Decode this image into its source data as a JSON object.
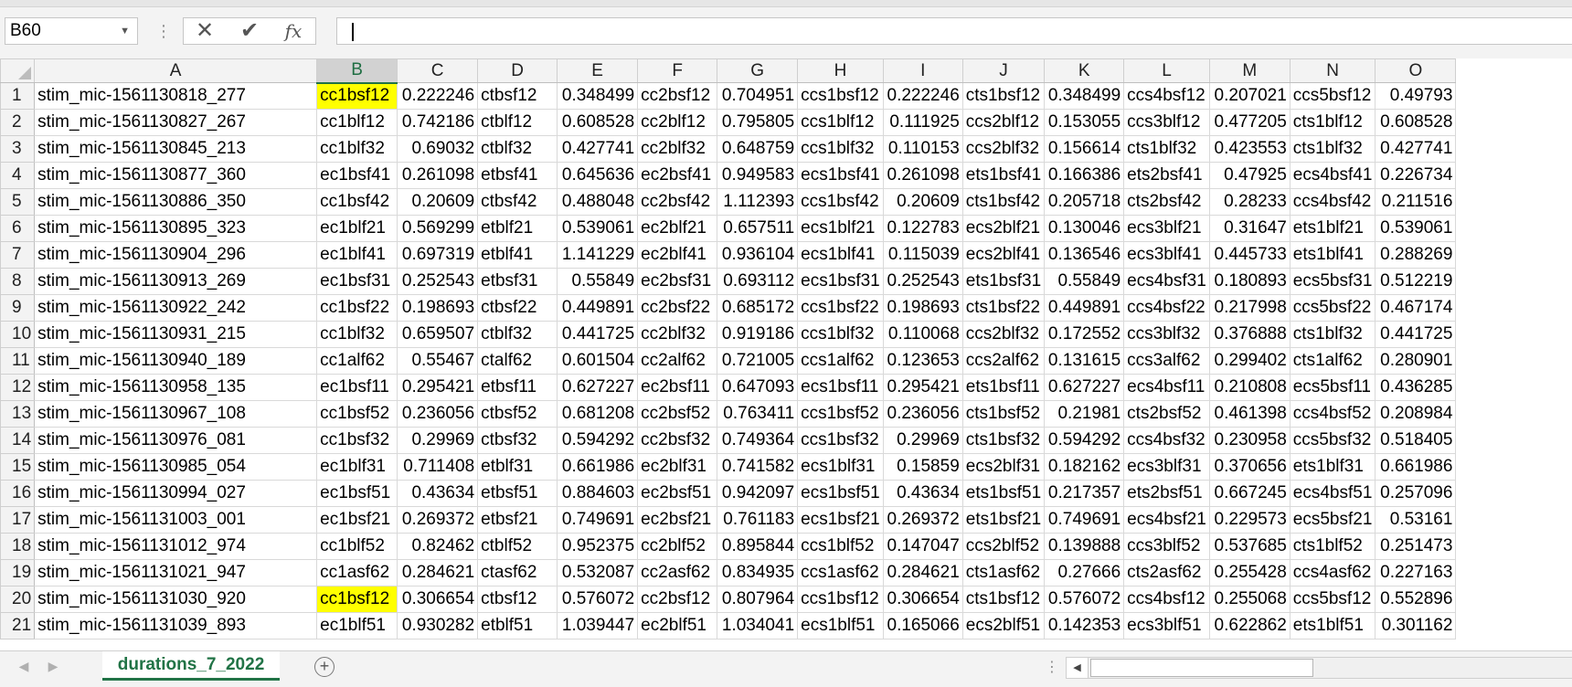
{
  "name_box": {
    "value": "B60"
  },
  "formula_bar": {
    "cancel_icon": "x-icon",
    "enter_icon": "check-icon",
    "function_label": "fx",
    "value": ""
  },
  "columns": [
    "A",
    "B",
    "C",
    "D",
    "E",
    "F",
    "G",
    "H",
    "I",
    "J",
    "K",
    "L",
    "M",
    "N",
    "O"
  ],
  "selected_column": "B",
  "rows": [
    {
      "n": "1",
      "cells": [
        "stim_mic-1561130818_277",
        "cc1bsf12",
        "0.222246",
        "ctbsf12",
        "0.348499",
        "cc2bsf12",
        "0.704951",
        "ccs1bsf12",
        "0.222246",
        "cts1bsf12",
        "0.348499",
        "ccs4bsf12",
        "0.207021",
        "ccs5bsf12",
        "0.49793"
      ]
    },
    {
      "n": "2",
      "cells": [
        "stim_mic-1561130827_267",
        "cc1blf12",
        "0.742186",
        "ctblf12",
        "0.608528",
        "cc2blf12",
        "0.795805",
        "ccs1blf12",
        "0.111925",
        "ccs2blf12",
        "0.153055",
        "ccs3blf12",
        "0.477205",
        "cts1blf12",
        "0.608528"
      ]
    },
    {
      "n": "3",
      "cells": [
        "stim_mic-1561130845_213",
        "cc1blf32",
        "0.69032",
        "ctblf32",
        "0.427741",
        "cc2blf32",
        "0.648759",
        "ccs1blf32",
        "0.110153",
        "ccs2blf32",
        "0.156614",
        "cts1blf32",
        "0.423553",
        "cts1blf32",
        "0.427741"
      ]
    },
    {
      "n": "4",
      "cells": [
        "stim_mic-1561130877_360",
        "ec1bsf41",
        "0.261098",
        "etbsf41",
        "0.645636",
        "ec2bsf41",
        "0.949583",
        "ecs1bsf41",
        "0.261098",
        "ets1bsf41",
        "0.166386",
        "ets2bsf41",
        "0.47925",
        "ecs4bsf41",
        "0.226734"
      ]
    },
    {
      "n": "5",
      "cells": [
        "stim_mic-1561130886_350",
        "cc1bsf42",
        "0.20609",
        "ctbsf42",
        "0.488048",
        "cc2bsf42",
        "1.112393",
        "ccs1bsf42",
        "0.20609",
        "cts1bsf42",
        "0.205718",
        "cts2bsf42",
        "0.28233",
        "ccs4bsf42",
        "0.211516"
      ]
    },
    {
      "n": "6",
      "cells": [
        "stim_mic-1561130895_323",
        "ec1blf21",
        "0.569299",
        "etblf21",
        "0.539061",
        "ec2blf21",
        "0.657511",
        "ecs1blf21",
        "0.122783",
        "ecs2blf21",
        "0.130046",
        "ecs3blf21",
        "0.31647",
        "ets1blf21",
        "0.539061"
      ]
    },
    {
      "n": "7",
      "cells": [
        "stim_mic-1561130904_296",
        "ec1blf41",
        "0.697319",
        "etblf41",
        "1.141229",
        "ec2blf41",
        "0.936104",
        "ecs1blf41",
        "0.115039",
        "ecs2blf41",
        "0.136546",
        "ecs3blf41",
        "0.445733",
        "ets1blf41",
        "0.288269"
      ]
    },
    {
      "n": "8",
      "cells": [
        "stim_mic-1561130913_269",
        "ec1bsf31",
        "0.252543",
        "etbsf31",
        "0.55849",
        "ec2bsf31",
        "0.693112",
        "ecs1bsf31",
        "0.252543",
        "ets1bsf31",
        "0.55849",
        "ecs4bsf31",
        "0.180893",
        "ecs5bsf31",
        "0.512219"
      ]
    },
    {
      "n": "9",
      "cells": [
        "stim_mic-1561130922_242",
        "cc1bsf22",
        "0.198693",
        "ctbsf22",
        "0.449891",
        "cc2bsf22",
        "0.685172",
        "ccs1bsf22",
        "0.198693",
        "cts1bsf22",
        "0.449891",
        "ccs4bsf22",
        "0.217998",
        "ccs5bsf22",
        "0.467174"
      ]
    },
    {
      "n": "10",
      "cells": [
        "stim_mic-1561130931_215",
        "cc1blf32",
        "0.659507",
        "ctblf32",
        "0.441725",
        "cc2blf32",
        "0.919186",
        "ccs1blf32",
        "0.110068",
        "ccs2blf32",
        "0.172552",
        "ccs3blf32",
        "0.376888",
        "cts1blf32",
        "0.441725"
      ]
    },
    {
      "n": "11",
      "cells": [
        "stim_mic-1561130940_189",
        "cc1alf62",
        "0.55467",
        "ctalf62",
        "0.601504",
        "cc2alf62",
        "0.721005",
        "ccs1alf62",
        "0.123653",
        "ccs2alf62",
        "0.131615",
        "ccs3alf62",
        "0.299402",
        "cts1alf62",
        "0.280901"
      ]
    },
    {
      "n": "12",
      "cells": [
        "stim_mic-1561130958_135",
        "ec1bsf11",
        "0.295421",
        "etbsf11",
        "0.627227",
        "ec2bsf11",
        "0.647093",
        "ecs1bsf11",
        "0.295421",
        "ets1bsf11",
        "0.627227",
        "ecs4bsf11",
        "0.210808",
        "ecs5bsf11",
        "0.436285"
      ]
    },
    {
      "n": "13",
      "cells": [
        "stim_mic-1561130967_108",
        "cc1bsf52",
        "0.236056",
        "ctbsf52",
        "0.681208",
        "cc2bsf52",
        "0.763411",
        "ccs1bsf52",
        "0.236056",
        "cts1bsf52",
        "0.21981",
        "cts2bsf52",
        "0.461398",
        "ccs4bsf52",
        "0.208984"
      ]
    },
    {
      "n": "14",
      "cells": [
        "stim_mic-1561130976_081",
        "cc1bsf32",
        "0.29969",
        "ctbsf32",
        "0.594292",
        "cc2bsf32",
        "0.749364",
        "ccs1bsf32",
        "0.29969",
        "cts1bsf32",
        "0.594292",
        "ccs4bsf32",
        "0.230958",
        "ccs5bsf32",
        "0.518405"
      ]
    },
    {
      "n": "15",
      "cells": [
        "stim_mic-1561130985_054",
        "ec1blf31",
        "0.711408",
        "etblf31",
        "0.661986",
        "ec2blf31",
        "0.741582",
        "ecs1blf31",
        "0.15859",
        "ecs2blf31",
        "0.182162",
        "ecs3blf31",
        "0.370656",
        "ets1blf31",
        "0.661986"
      ]
    },
    {
      "n": "16",
      "cells": [
        "stim_mic-1561130994_027",
        "ec1bsf51",
        "0.43634",
        "etbsf51",
        "0.884603",
        "ec2bsf51",
        "0.942097",
        "ecs1bsf51",
        "0.43634",
        "ets1bsf51",
        "0.217357",
        "ets2bsf51",
        "0.667245",
        "ecs4bsf51",
        "0.257096"
      ]
    },
    {
      "n": "17",
      "cells": [
        "stim_mic-1561131003_001",
        "ec1bsf21",
        "0.269372",
        "etbsf21",
        "0.749691",
        "ec2bsf21",
        "0.761183",
        "ecs1bsf21",
        "0.269372",
        "ets1bsf21",
        "0.749691",
        "ecs4bsf21",
        "0.229573",
        "ecs5bsf21",
        "0.53161"
      ]
    },
    {
      "n": "18",
      "cells": [
        "stim_mic-1561131012_974",
        "cc1blf52",
        "0.82462",
        "ctblf52",
        "0.952375",
        "cc2blf52",
        "0.895844",
        "ccs1blf52",
        "0.147047",
        "ccs2blf52",
        "0.139888",
        "ccs3blf52",
        "0.537685",
        "cts1blf52",
        "0.251473"
      ]
    },
    {
      "n": "19",
      "cells": [
        "stim_mic-1561131021_947",
        "cc1asf62",
        "0.284621",
        "ctasf62",
        "0.532087",
        "cc2asf62",
        "0.834935",
        "ccs1asf62",
        "0.284621",
        "cts1asf62",
        "0.27666",
        "cts2asf62",
        "0.255428",
        "ccs4asf62",
        "0.227163"
      ]
    },
    {
      "n": "20",
      "cells": [
        "stim_mic-1561131030_920",
        "cc1bsf12",
        "0.306654",
        "ctbsf12",
        "0.576072",
        "cc2bsf12",
        "0.807964",
        "ccs1bsf12",
        "0.306654",
        "cts1bsf12",
        "0.576072",
        "ccs4bsf12",
        "0.255068",
        "ccs5bsf12",
        "0.552896"
      ]
    },
    {
      "n": "21",
      "cells": [
        "stim_mic-1561131039_893",
        "ec1blf51",
        "0.930282",
        "etblf51",
        "1.039447",
        "ec2blf51",
        "1.034041",
        "ecs1blf51",
        "0.165066",
        "ecs2blf51",
        "0.142353",
        "ecs3blf51",
        "0.622862",
        "ets1blf51",
        "0.301162"
      ]
    }
  ],
  "highlighted_cells": [
    {
      "row": 1,
      "col": "B"
    },
    {
      "row": 20,
      "col": "B"
    }
  ],
  "highlight_color": "#ffff00",
  "sheet_tabs": [
    {
      "label": "durations_7_2022",
      "active": true
    }
  ],
  "accent_color": "#217346"
}
